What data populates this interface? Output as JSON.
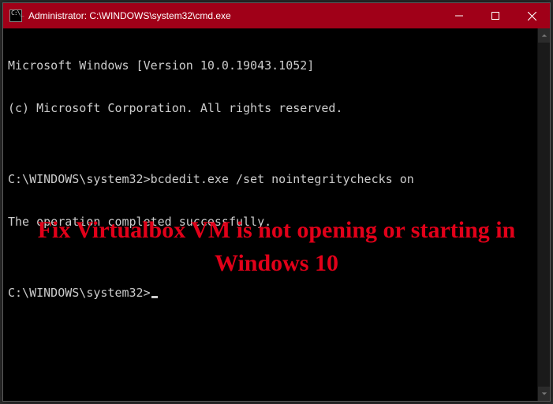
{
  "window": {
    "title": "Administrator: C:\\WINDOWS\\system32\\cmd.exe"
  },
  "terminal": {
    "line1": "Microsoft Windows [Version 10.0.19043.1052]",
    "line2": "(c) Microsoft Corporation. All rights reserved.",
    "blank1": "",
    "line3": "C:\\WINDOWS\\system32>bcdedit.exe /set nointegritychecks on",
    "line4": "The operation completed successfully.",
    "blank2": "",
    "prompt": "C:\\WINDOWS\\system32>"
  },
  "overlay": {
    "text": "Fix Virtualbox VM is not opening or starting in Windows 10"
  },
  "colors": {
    "titlebar": "#a00018",
    "overlay_text": "#e20019"
  }
}
